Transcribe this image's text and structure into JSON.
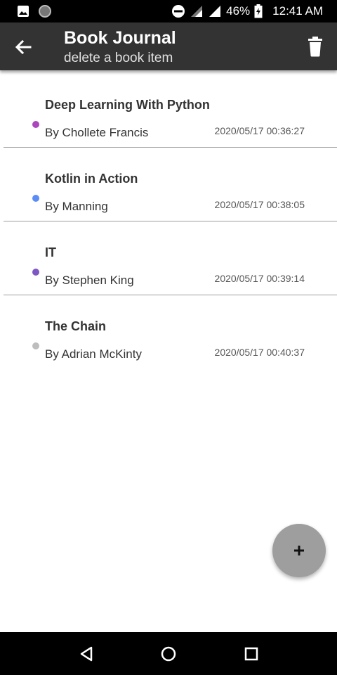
{
  "status_bar": {
    "battery": "46%",
    "time": "12:41 AM",
    "icons": [
      "image-icon",
      "circle-icon",
      "dnd-icon",
      "signal-icon",
      "signal-icon",
      "battery-charging-icon"
    ]
  },
  "app_bar": {
    "title": "Book Journal",
    "subtitle": "delete a book item",
    "back_icon": "arrow-left-icon",
    "action_icon": "trash-icon"
  },
  "books": [
    {
      "title": "Deep Learning With Python",
      "author": "By Chollete Francis",
      "date": "2020/05/17 00:36:27",
      "color": "#ab47bc"
    },
    {
      "title": "Kotlin in Action",
      "author": "By Manning",
      "date": "2020/05/17 00:38:05",
      "color": "#5c8df6"
    },
    {
      "title": "IT",
      "author": "By Stephen King",
      "date": "2020/05/17 00:39:14",
      "color": "#7e57c2"
    },
    {
      "title": "The Chain",
      "author": "By Adrian McKinty",
      "date": "2020/05/17 00:40:37",
      "color": "#bdbdbd"
    }
  ],
  "fab": {
    "icon": "plus-icon",
    "color": "#9e9e9e"
  },
  "nav_bar": {
    "icons": [
      "back-triangle-icon",
      "home-circle-icon",
      "recents-square-icon"
    ]
  }
}
